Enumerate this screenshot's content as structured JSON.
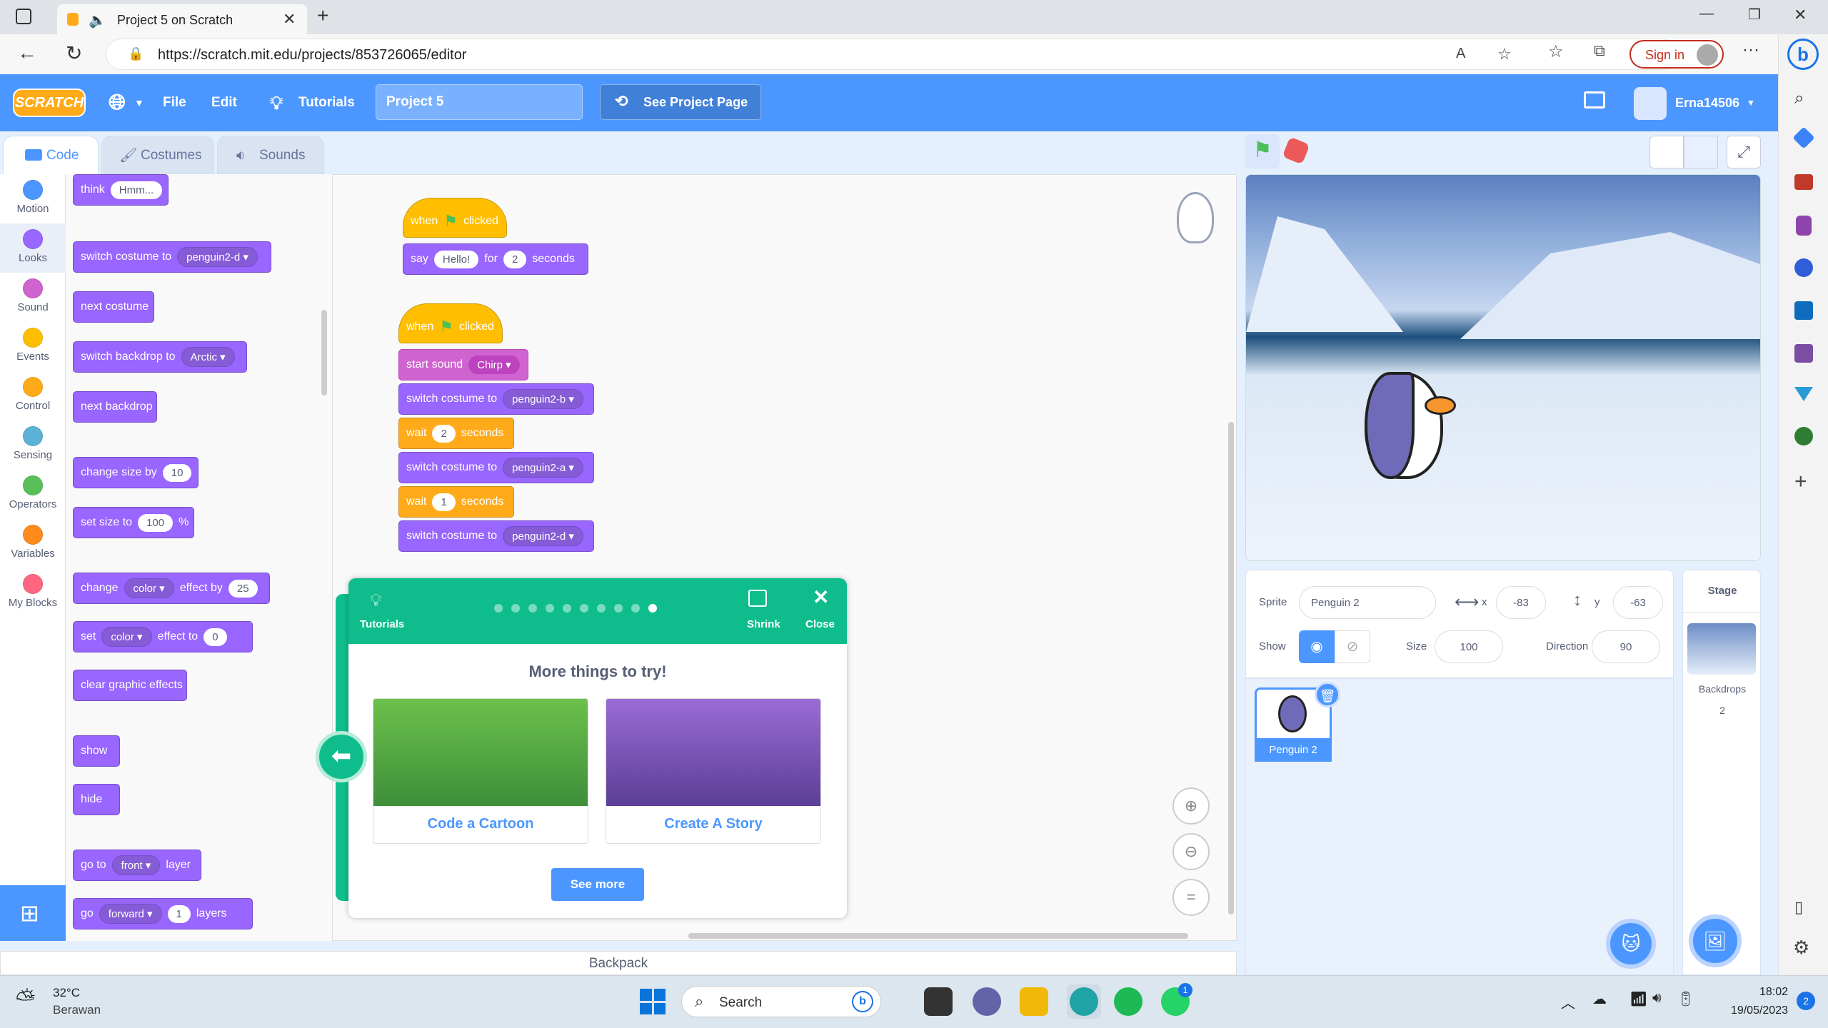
{
  "browser": {
    "tab_title": "Project 5 on Scratch",
    "url": "https://scratch.mit.edu/projects/853726065/editor",
    "signin_label": "Sign in"
  },
  "menu": {
    "logo": "SCRATCH",
    "file": "File",
    "edit": "Edit",
    "tutorials": "Tutorials",
    "project_title": "Project 5",
    "see_project": "See Project Page",
    "username": "Erna14506"
  },
  "tabs": {
    "code": "Code",
    "costumes": "Costumes",
    "sounds": "Sounds"
  },
  "categories": [
    {
      "label": "Motion",
      "color": "#4c97ff"
    },
    {
      "label": "Looks",
      "color": "#9966ff"
    },
    {
      "label": "Sound",
      "color": "#cf63cf"
    },
    {
      "label": "Events",
      "color": "#ffbf00"
    },
    {
      "label": "Control",
      "color": "#ffab19"
    },
    {
      "label": "Sensing",
      "color": "#5cb1d6"
    },
    {
      "label": "Operators",
      "color": "#59c059"
    },
    {
      "label": "Variables",
      "color": "#ff8c1a"
    },
    {
      "label": "My Blocks",
      "color": "#ff6680"
    }
  ],
  "palette": {
    "think": "think",
    "think_val": "Hmm...",
    "switch_costume": "switch costume to",
    "switch_costume_val": "penguin2-d",
    "next_costume": "next costume",
    "switch_backdrop": "switch backdrop to",
    "switch_backdrop_val": "Arctic",
    "next_backdrop": "next backdrop",
    "change_size": "change size by",
    "change_size_val": "10",
    "set_size": "set size to",
    "set_size_val": "100",
    "set_size_unit": "%",
    "change_effect": "change",
    "change_effect_drop": "color",
    "change_effect_by": "effect by",
    "change_effect_val": "25",
    "set_effect": "set",
    "set_effect_drop": "color",
    "set_effect_to": "effect to",
    "set_effect_val": "0",
    "clear_effects": "clear graphic effects",
    "show": "show",
    "hide": "hide",
    "goto": "go to",
    "goto_drop": "front",
    "goto_layer": "layer",
    "go": "go",
    "go_drop": "forward",
    "go_val": "1",
    "go_layers": "layers"
  },
  "script1": {
    "when": "when",
    "clicked": "clicked",
    "say": "say",
    "say_val": "Hello!",
    "for": "for",
    "for_val": "2",
    "seconds": "seconds"
  },
  "script2": {
    "when": "when",
    "clicked": "clicked",
    "start_sound": "start sound",
    "sound_val": "Chirp",
    "sc1": "switch costume to",
    "sc1_val": "penguin2-b",
    "wait1": "wait",
    "wait1_val": "2",
    "wait1_unit": "seconds",
    "sc2": "switch costume to",
    "sc2_val": "penguin2-a",
    "wait2": "wait",
    "wait2_val": "1",
    "wait2_unit": "seconds",
    "sc3": "switch costume to",
    "sc3_val": "penguin2-d"
  },
  "tutorial": {
    "label": "Tutorials",
    "shrink": "Shrink",
    "close": "Close",
    "heading": "More things to try!",
    "card1": "Code a Cartoon",
    "card2": "Create A Story",
    "see_more": "See more",
    "steps_total": 10,
    "step_current": 10
  },
  "sprite": {
    "sprite_label": "Sprite",
    "name": "Penguin 2",
    "x_label": "x",
    "x": "-83",
    "y_label": "y",
    "y": "-63",
    "show_label": "Show",
    "size_label": "Size",
    "size": "100",
    "direction_label": "Direction",
    "direction": "90",
    "thumb_name": "Penguin 2"
  },
  "stage_panel": {
    "title": "Stage",
    "backdrops_label": "Backdrops",
    "backdrops_count": "2"
  },
  "backpack": "Backpack",
  "taskbar": {
    "temp": "32°C",
    "weather": "Berawan",
    "search": "Search",
    "time": "18:02",
    "date": "19/05/2023",
    "whatsapp_badge": "1",
    "notif_count": "2"
  }
}
